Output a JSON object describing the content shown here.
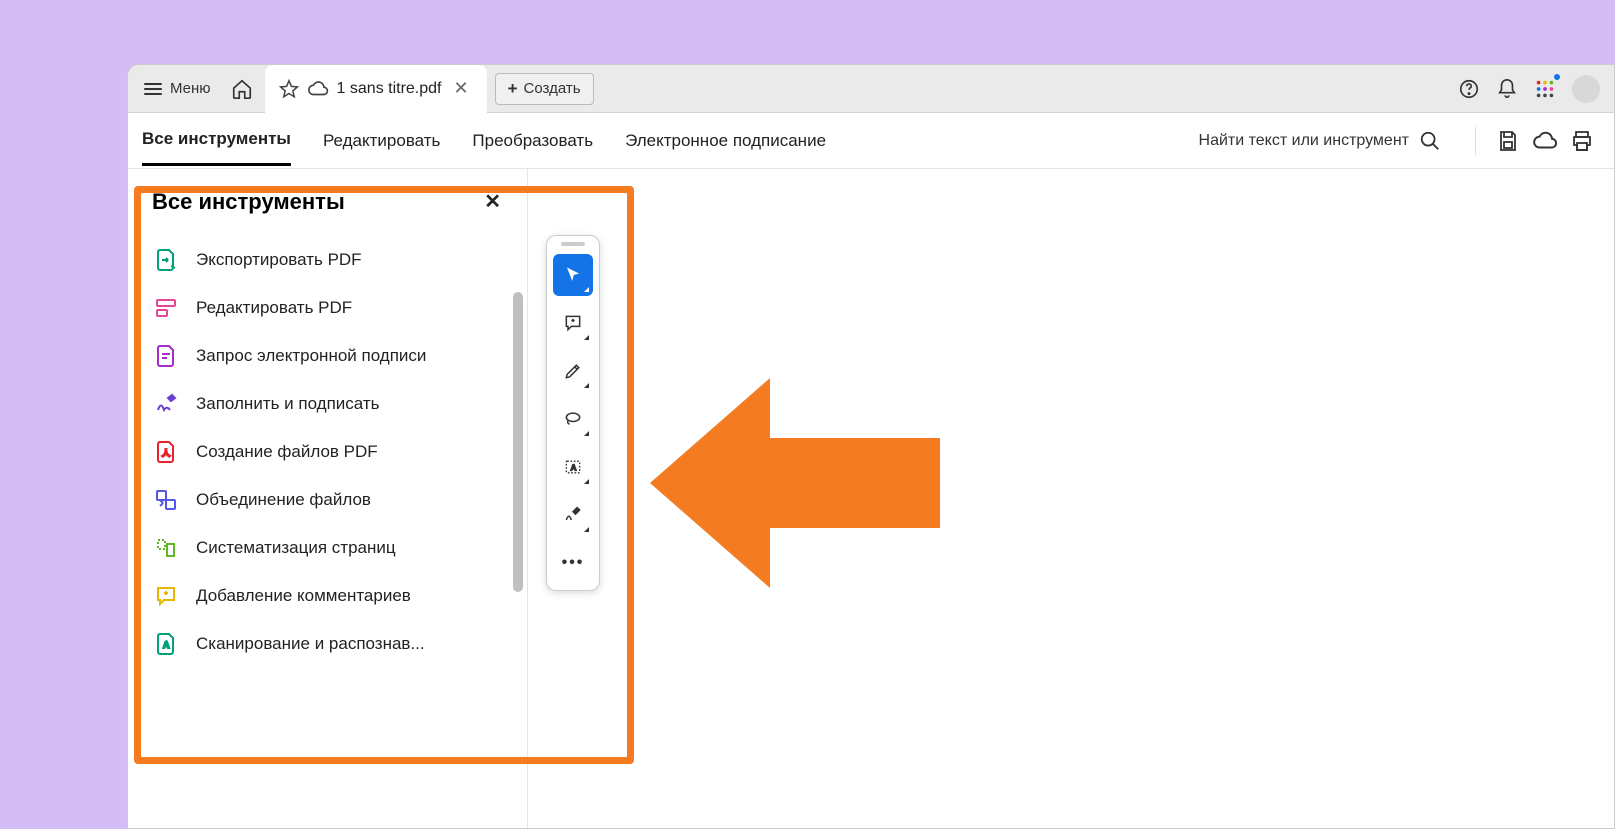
{
  "titlebar": {
    "menu_label": "Меню",
    "tab_title": "1 sans titre.pdf",
    "create_label": "Создать"
  },
  "toolbar": {
    "tabs": [
      {
        "label": "Все инструменты",
        "active": true
      },
      {
        "label": "Редактировать",
        "active": false
      },
      {
        "label": "Преобразовать",
        "active": false
      },
      {
        "label": "Электронное подписание",
        "active": false
      }
    ],
    "search_placeholder": "Найти текст или инструмент"
  },
  "panel": {
    "title": "Все инструменты",
    "items": [
      {
        "label": "Экспортировать PDF",
        "color": "#00a07b"
      },
      {
        "label": "Редактировать PDF",
        "color": "#e34796"
      },
      {
        "label": "Запрос электронной подписи",
        "color": "#a72cc9"
      },
      {
        "label": "Заполнить и подписать",
        "color": "#6a3fd6"
      },
      {
        "label": "Создание файлов PDF",
        "color": "#e8232a"
      },
      {
        "label": "Объединение файлов",
        "color": "#5258e4"
      },
      {
        "label": "Систематизация страниц",
        "color": "#5fb823"
      },
      {
        "label": "Добавление комментариев",
        "color": "#e8b600"
      },
      {
        "label": "Сканирование и распознав...",
        "color": "#00a07b"
      }
    ]
  },
  "colors": {
    "orange": "#f47b20",
    "blue": "#1473e6"
  }
}
